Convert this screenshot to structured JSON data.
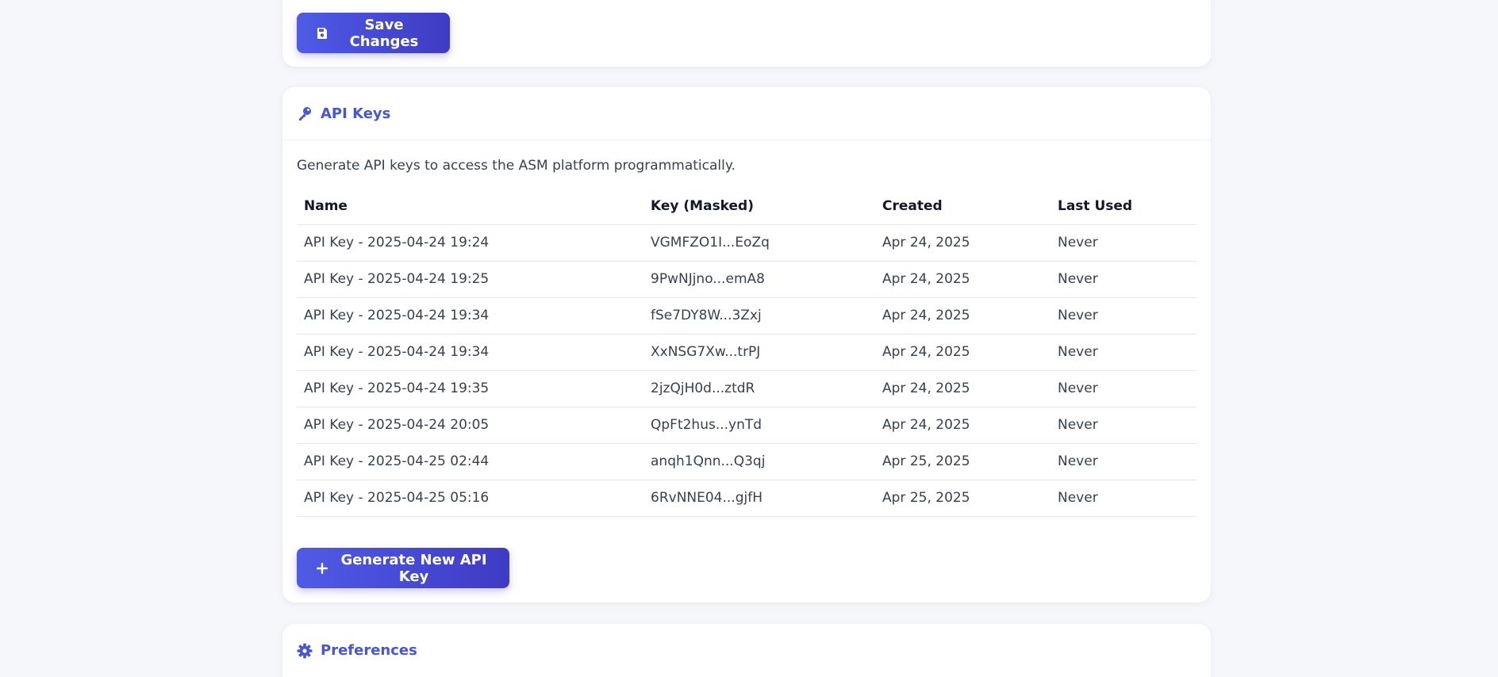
{
  "top_section": {
    "save_label": "Save Changes"
  },
  "api_keys": {
    "title": "API Keys",
    "description": "Generate API keys to access the ASM platform programmatically.",
    "columns": [
      "Name",
      "Key (Masked)",
      "Created",
      "Last Used"
    ],
    "rows": [
      [
        "API Key - 2025-04-24 19:24",
        "VGMFZO1I...EoZq",
        "Apr 24, 2025",
        "Never"
      ],
      [
        "API Key - 2025-04-24 19:25",
        "9PwNJjno...emA8",
        "Apr 24, 2025",
        "Never"
      ],
      [
        "API Key - 2025-04-24 19:34",
        "fSe7DY8W...3Zxj",
        "Apr 24, 2025",
        "Never"
      ],
      [
        "API Key - 2025-04-24 19:34",
        "XxNSG7Xw...trPJ",
        "Apr 24, 2025",
        "Never"
      ],
      [
        "API Key - 2025-04-24 19:35",
        "2jzQjH0d...ztdR",
        "Apr 24, 2025",
        "Never"
      ],
      [
        "API Key - 2025-04-24 20:05",
        "QpFt2hus...ynTd",
        "Apr 24, 2025",
        "Never"
      ],
      [
        "API Key - 2025-04-25 02:44",
        "anqh1Qnn...Q3qj",
        "Apr 25, 2025",
        "Never"
      ],
      [
        "API Key - 2025-04-25 05:16",
        "6RvNNE04...gjfH",
        "Apr 25, 2025",
        "Never"
      ]
    ],
    "generate_label": "Generate New API Key"
  },
  "preferences": {
    "title": "Preferences"
  },
  "icons": {
    "save": "save-icon",
    "key": "key-icon",
    "plus": "plus-icon",
    "gear": "gear-icon"
  },
  "colors": {
    "accent": "#4655d9",
    "button_start": "#4f5be6",
    "button_end": "#3f3bc4",
    "background": "#f5f7fb"
  }
}
